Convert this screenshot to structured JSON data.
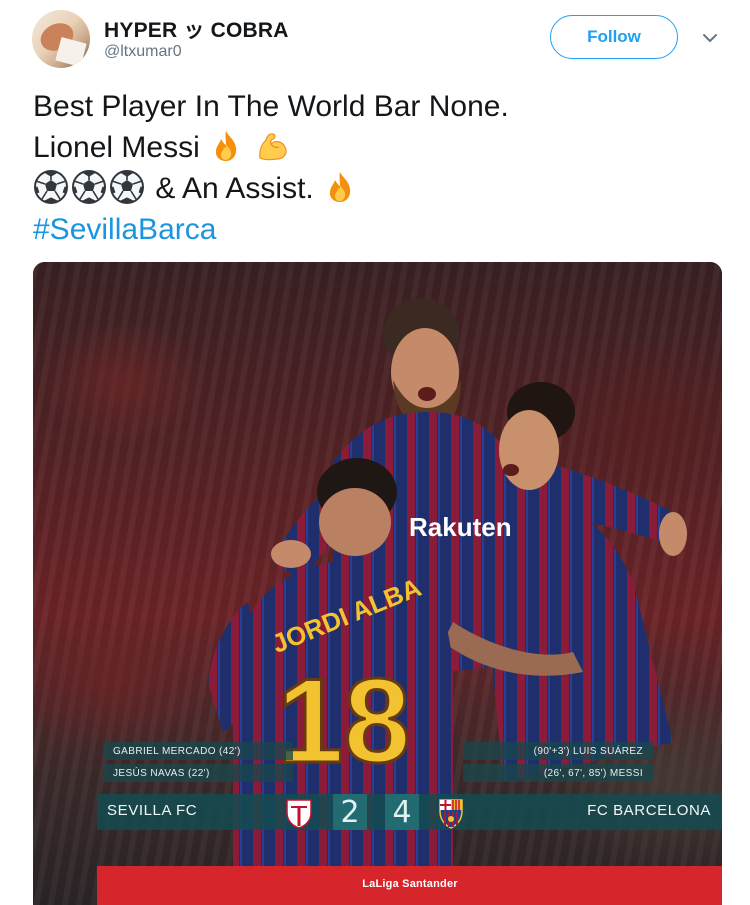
{
  "user": {
    "display_name": "HYPER ッ COBRA",
    "handle": "@ltxumar0"
  },
  "actions": {
    "follow_label": "Follow"
  },
  "tweet": {
    "line1": "Best Player In The World Bar None.",
    "line2": "Lionel Messi",
    "line3": "& An Assist.",
    "hashtag": "#SevillaBarca",
    "emoji_line2": [
      "fire-emoji",
      "flexed-biceps-emoji"
    ],
    "emoji_line3": [
      "soccer-ball-emoji",
      "soccer-ball-emoji",
      "soccer-ball-emoji"
    ],
    "emoji_line3_end": "fire-emoji"
  },
  "media": {
    "jersey_name": "JORDI ALBA",
    "jersey_number": "18",
    "sponsor": "Rakuten",
    "scoreboard": {
      "home_scorer_1": "GABRIEL MERCADO (42')",
      "home_scorer_2": "JESÚS NAVAS (22')",
      "away_scorer_1": "(90'+3') LUIS SUÁREZ",
      "away_scorer_2": "(26', 67', 85') MESSI",
      "home_team": "SEVILLA FC",
      "away_team": "FC BARCELONA",
      "home_score": "2",
      "away_score": "4",
      "league_branding": "LaLiga Santander"
    }
  },
  "colors": {
    "link": "#1b95e0",
    "follow_blue": "#1da1f2",
    "scoreboard_teal": "#144b50",
    "laliga_red": "#d6252b"
  }
}
